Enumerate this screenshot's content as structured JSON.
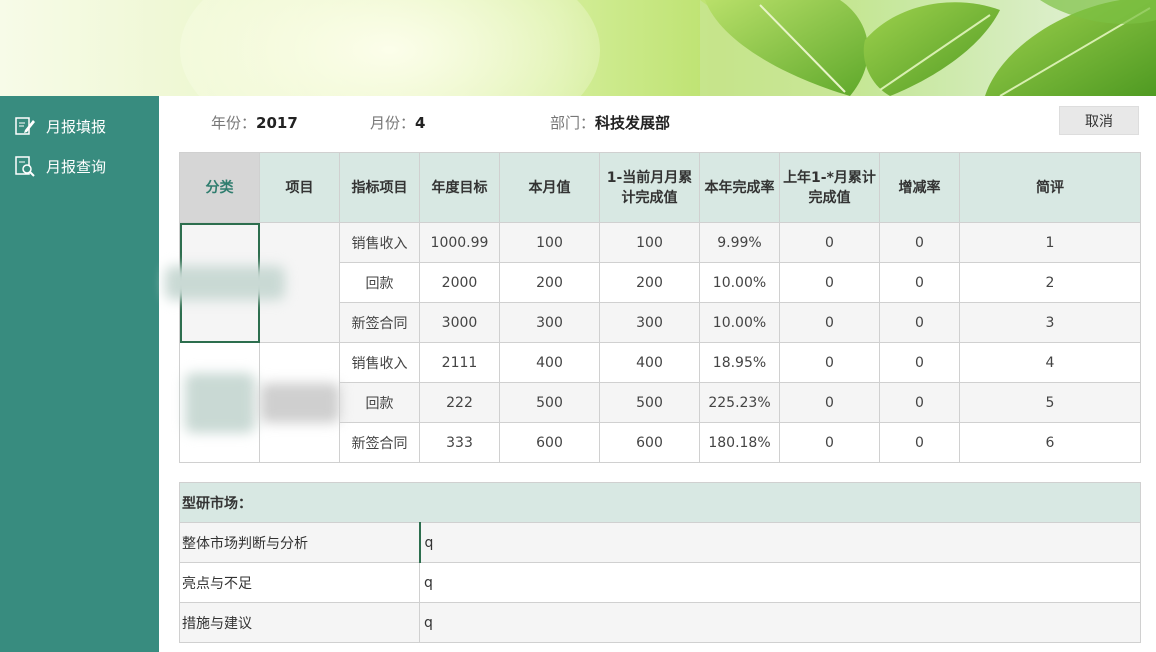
{
  "sidebar": {
    "items": [
      {
        "label": "月报填报",
        "icon": "edit-icon"
      },
      {
        "label": "月报查询",
        "icon": "search-doc-icon"
      }
    ]
  },
  "header": {
    "year_label": "年份：",
    "year_value": "2017",
    "month_label": "月份：",
    "month_value": "4",
    "dept_label": "部门：",
    "dept_value": "科技发展部",
    "cancel_label": "取消"
  },
  "table": {
    "columns": [
      "分类",
      "项目",
      "指标项目",
      "年度目标",
      "本月值",
      "1-当前月月累计完成值",
      "本年完成率",
      "上年1-*月累计完成值",
      "增减率",
      "简评"
    ],
    "rows": [
      [
        "销售收入",
        "1000.99",
        "100",
        "100",
        "9.99%",
        "0",
        "0",
        "1"
      ],
      [
        "回款",
        "2000",
        "200",
        "200",
        "10.00%",
        "0",
        "0",
        "2"
      ],
      [
        "新签合同",
        "3000",
        "300",
        "300",
        "10.00%",
        "0",
        "0",
        "3"
      ],
      [
        "销售收入",
        "2111",
        "400",
        "400",
        "18.95%",
        "0",
        "0",
        "4"
      ],
      [
        "回款",
        "222",
        "500",
        "500",
        "225.23%",
        "0",
        "0",
        "5"
      ],
      [
        "新签合同",
        "333",
        "600",
        "600",
        "180.18%",
        "0",
        "0",
        "6"
      ]
    ]
  },
  "notes": {
    "title": "型研市场：",
    "rows": [
      {
        "label": "整体市场判断与分析",
        "value": "q"
      },
      {
        "label": "亮点与不足",
        "value": "q"
      },
      {
        "label": "措施与建议",
        "value": "q"
      }
    ]
  },
  "colors": {
    "sidebar": "#388c7f",
    "header_row": "#d8e8e3",
    "accent": "#2f7d6e"
  }
}
